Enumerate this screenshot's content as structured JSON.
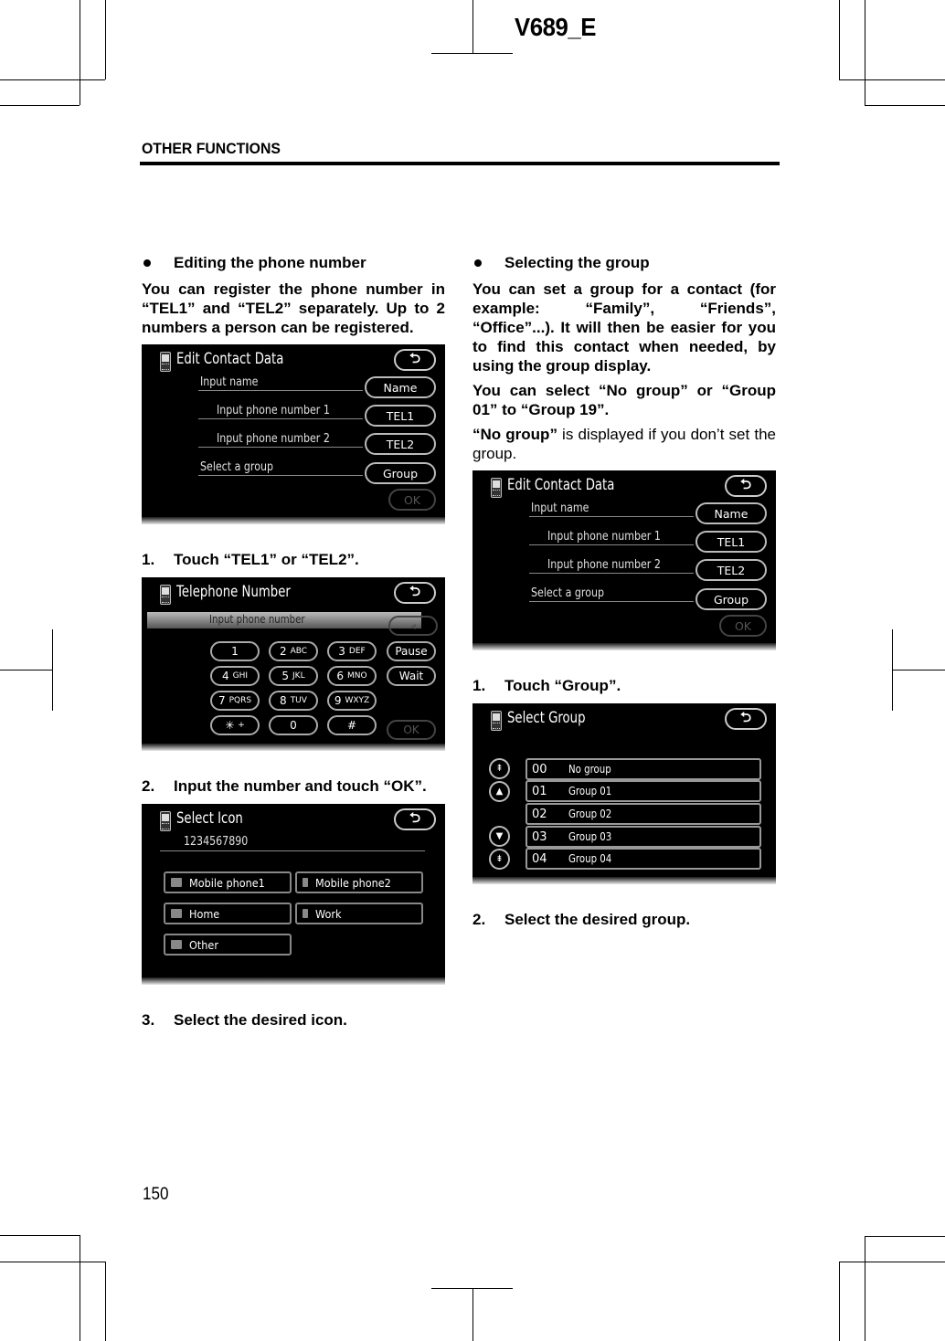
{
  "header": {
    "doc_code": "V689_E",
    "section_title": "OTHER FUNCTIONS",
    "page_number": "150"
  },
  "left_column": {
    "heading": "Editing the phone number",
    "intro": "You can register the phone number in “TEL1” and “TEL2” separately. Up to 2 numbers a person can be registered.",
    "screen_edit": {
      "title": "Edit Contact Data",
      "back_glyph": "⮌",
      "rows": [
        {
          "label": "Input name",
          "button": "Name"
        },
        {
          "label": "Input phone number 1",
          "button": "TEL1"
        },
        {
          "label": "Input phone number 2",
          "button": "TEL2"
        },
        {
          "label": "Select a group",
          "button": "Group"
        }
      ],
      "ok": "OK"
    },
    "step1": {
      "num": "1.",
      "text": "Touch “TEL1” or “TEL2”."
    },
    "screen_phone": {
      "title": "Telephone Number",
      "input_label": "Input phone number",
      "delete_glyph": "◂",
      "keys": [
        {
          "digit": "1",
          "letters": ""
        },
        {
          "digit": "2",
          "letters": "ABC"
        },
        {
          "digit": "3",
          "letters": "DEF"
        },
        {
          "digit": "4",
          "letters": "GHI"
        },
        {
          "digit": "5",
          "letters": "JKL"
        },
        {
          "digit": "6",
          "letters": "MNO"
        },
        {
          "digit": "7",
          "letters": "PQRS"
        },
        {
          "digit": "8",
          "letters": "TUV"
        },
        {
          "digit": "9",
          "letters": "WXYZ"
        },
        {
          "digit": "✳",
          "letters": "+"
        },
        {
          "digit": "0",
          "letters": ""
        },
        {
          "digit": "#",
          "letters": ""
        }
      ],
      "pause": "Pause",
      "wait": "Wait",
      "ok": "OK"
    },
    "step2": {
      "num": "2.",
      "text": "Input the number and touch “OK”."
    },
    "screen_icon": {
      "title": "Select Icon",
      "number": "1234567890",
      "options": [
        "Mobile phone1",
        "Mobile phone2",
        "Home",
        "Work",
        "Other"
      ]
    },
    "step3": {
      "num": "3.",
      "text": "Select the desired icon."
    }
  },
  "right_column": {
    "heading": "Selecting the group",
    "para1": "You can set a group for a contact (for example: “Family”, “Friends”, “Office”...). It will then be easier for you to find this contact when needed, by using the group display.",
    "para2": "You can select “No group” or “Group 01” to “Group 19”.",
    "para3_bold": "“No group”",
    "para3_rest": " is displayed if you don’t set the group.",
    "screen_edit": {
      "title": "Edit Contact Data",
      "rows": [
        {
          "label": "Input name",
          "button": "Name"
        },
        {
          "label": "Input phone number 1",
          "button": "TEL1"
        },
        {
          "label": "Input phone number 2",
          "button": "TEL2"
        },
        {
          "label": "Select a group",
          "button": "Group"
        }
      ],
      "ok": "OK"
    },
    "step1": {
      "num": "1.",
      "text": "Touch “Group”."
    },
    "screen_group": {
      "title": "Select Group",
      "groups": [
        {
          "num": "00",
          "name": "No group"
        },
        {
          "num": "01",
          "name": "Group 01"
        },
        {
          "num": "02",
          "name": "Group 02"
        },
        {
          "num": "03",
          "name": "Group 03"
        },
        {
          "num": "04",
          "name": "Group 04"
        }
      ],
      "scroll": {
        "page_up": "⇞",
        "up": "▲",
        "down": "▼",
        "page_down": "⇟"
      }
    },
    "step2": {
      "num": "2.",
      "text": "Select the desired group."
    }
  }
}
